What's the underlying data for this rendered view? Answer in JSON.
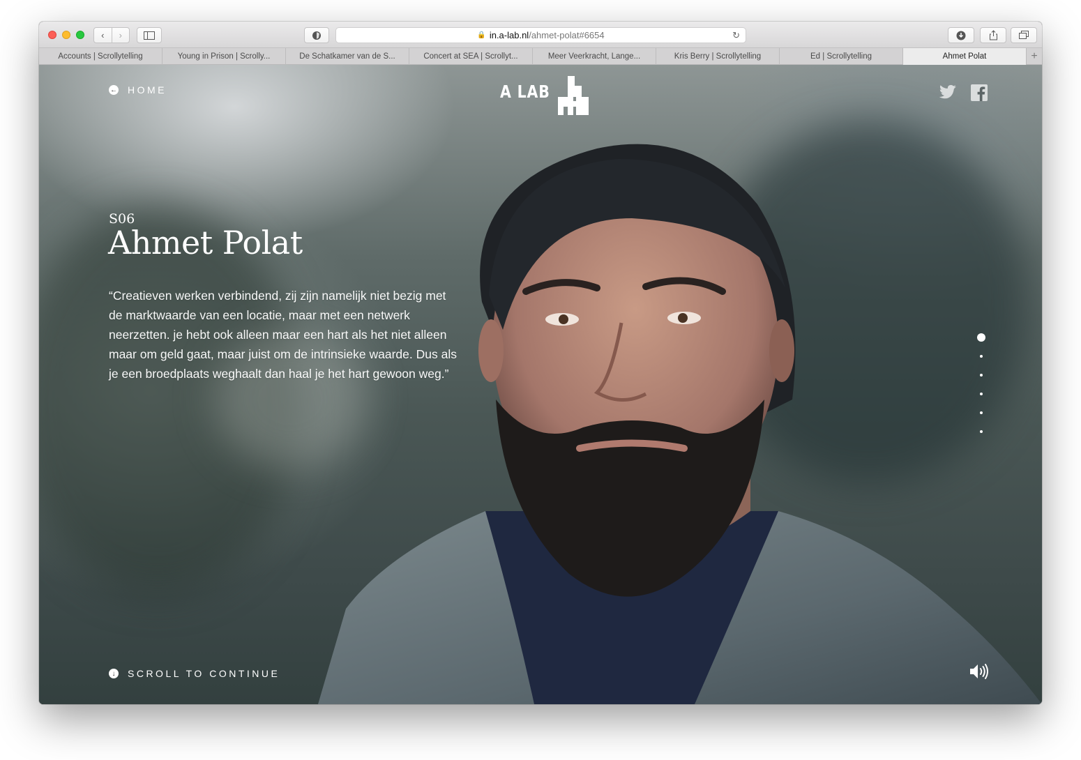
{
  "browser": {
    "url_domain": "in.a-lab.nl",
    "url_path": "/ahmet-polat#6654",
    "tabs": [
      {
        "label": "Accounts | Scrollytelling",
        "active": false
      },
      {
        "label": "Young in Prison | Scrolly...",
        "active": false
      },
      {
        "label": "De Schatkamer van de S...",
        "active": false
      },
      {
        "label": "Concert at SEA | Scrollyt...",
        "active": false
      },
      {
        "label": "Meer Veerkracht, Lange...",
        "active": false
      },
      {
        "label": "Kris Berry | Scrollytelling",
        "active": false
      },
      {
        "label": "Ed | Scrollytelling",
        "active": false
      },
      {
        "label": "Ahmet Polat",
        "active": true
      }
    ],
    "new_tab_label": "+"
  },
  "header": {
    "home_label": "HOME",
    "logo_text": "A LAB",
    "social_icons": [
      "twitter-icon",
      "facebook-icon"
    ]
  },
  "story": {
    "episode": "S06",
    "name": "Ahmet Polat",
    "quote": "“Creatieven werken verbindend, zij zijn namelijk niet bezig met de marktwaarde van een locatie, maar met een netwerk neerzetten. je hebt ook alleen maar een hart als het niet alleen maar om geld gaat, maar juist om de intrinsieke waarde. Dus als je een broedplaats weghaalt dan haal je het hart gewoon weg.”"
  },
  "pagination": {
    "total": 6,
    "active": 1
  },
  "footer": {
    "scroll_label": "SCROLL TO CONTINUE",
    "sound_icon": "speaker-icon"
  },
  "colors": {
    "text": "#ffffff",
    "tab_active": "#ececec"
  }
}
